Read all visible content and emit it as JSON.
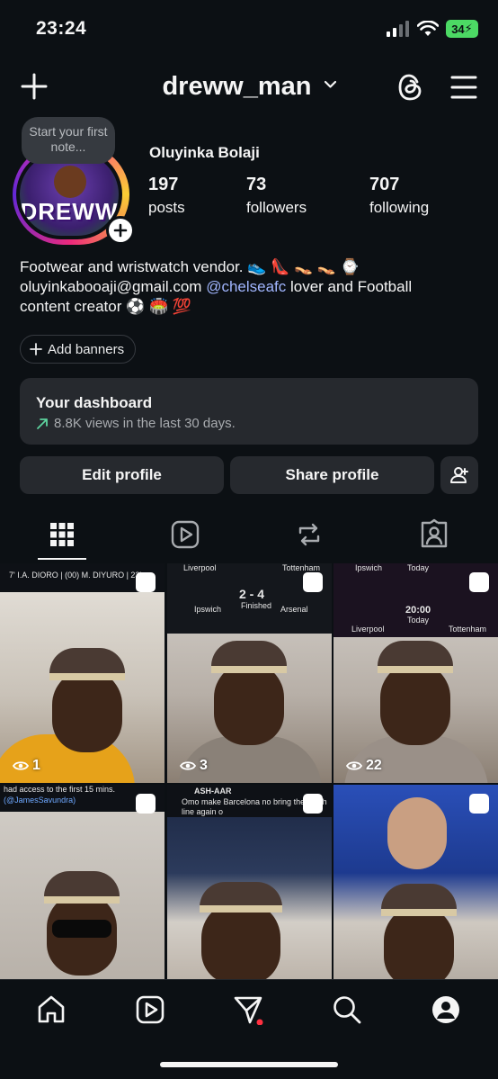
{
  "status_bar": {
    "time": "23:24",
    "battery": "34"
  },
  "header": {
    "username": "dreww_man"
  },
  "profile": {
    "note_placeholder": "Start your first note...",
    "avatar_text": "DREWW",
    "full_name": "Oluyinka Bolaji",
    "stats": [
      {
        "value": "197",
        "label": "posts"
      },
      {
        "value": "73",
        "label": "followers"
      },
      {
        "value": "707",
        "label": "following"
      }
    ],
    "bio": {
      "line1": "Footwear and wristwatch vendor. 👟 👠 👡 👡 ⌚",
      "line2_a": "oluyinkabooaji@gmail.com ",
      "mention": "@chelseafc",
      "line2_b": " lover and Football",
      "line3": "content creator ⚽ 🏟️ 💯"
    },
    "add_banners_label": "Add banners"
  },
  "dashboard": {
    "title": "Your dashboard",
    "subtitle": "8.8K views in the last 30 days."
  },
  "buttons": {
    "edit_profile": "Edit profile",
    "share_profile": "Share profile"
  },
  "grid": {
    "views": [
      "1",
      "3",
      "22"
    ],
    "captions": {
      "cell1_top": "7' I.A. DIORO  |  (00) M. DIYURO | 23'",
      "cell2_top_left": "Liverpool",
      "cell2_top_right": "Tottenham",
      "cell2_score": "2 - 4",
      "cell2_status": "Finished",
      "cell2_team_a": "Ipswich",
      "cell2_team_b": "Arsenal",
      "cell3_top_left": "Ipswich",
      "cell3_top_mid": "Today",
      "cell3_time": "20:00",
      "cell3_day": "Today",
      "cell3_team_a": "Liverpool",
      "cell3_team_b": "Tottenham",
      "cell4_line1": "had access to the first 15 mins.",
      "cell4_line2": "(@JamesSavundra)",
      "cell5_handle": "ASH-AAR",
      "cell5_line1": "Omo make Barcelona no bring their high",
      "cell5_line2": "line again o"
    }
  },
  "colors": {
    "background": "#0c1014",
    "button": "#26292e",
    "mention": "#a1b6ff",
    "trend": "#5dd39e"
  },
  "icons": [
    "plus-icon",
    "chevron-down-icon",
    "threads-icon",
    "menu-icon",
    "grid-icon",
    "reels-icon",
    "reposts-icon",
    "tagged-icon",
    "home-icon",
    "reels-nav-icon",
    "direct-icon",
    "search-icon",
    "profile-icon",
    "add-person-icon",
    "trend-up-icon",
    "eye-icon"
  ]
}
